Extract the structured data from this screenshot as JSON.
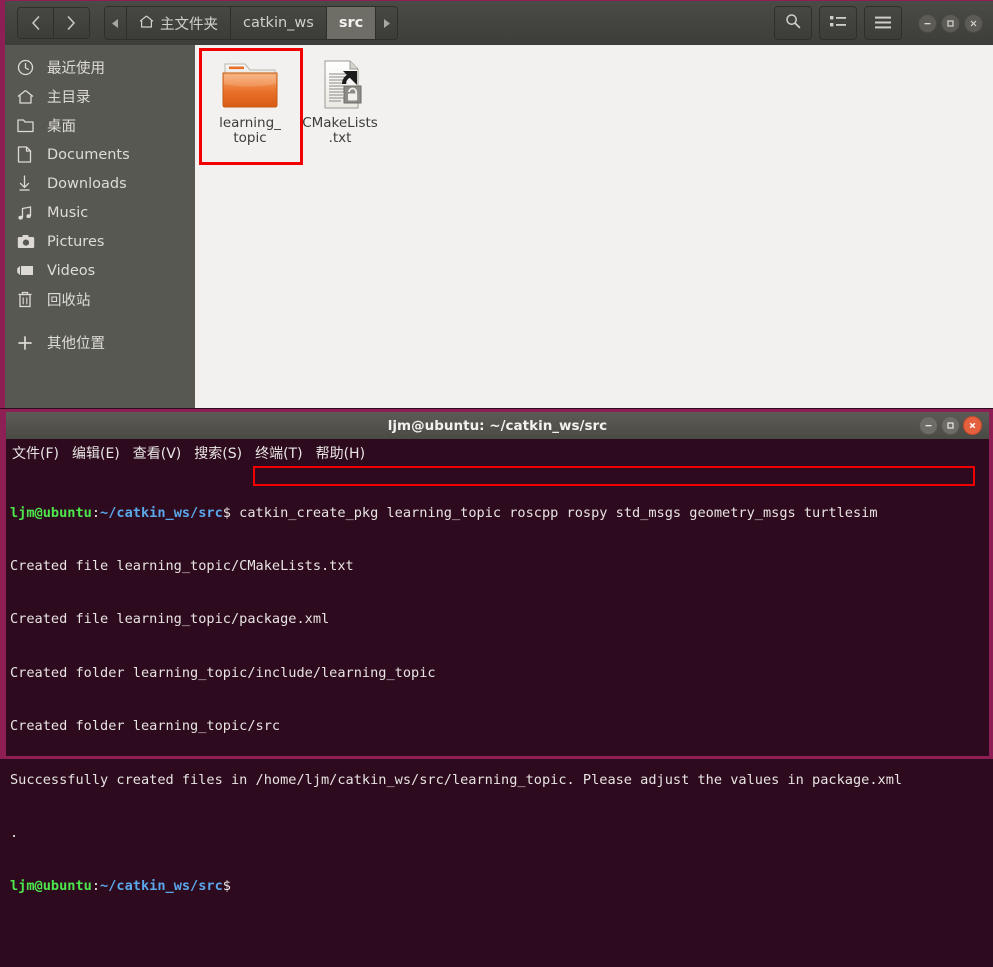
{
  "file_manager": {
    "nav": {
      "back": "‹",
      "forward": "›"
    },
    "breadcrumb": {
      "left_arrow": "◂",
      "right_arrow": "▸",
      "items": [
        {
          "label": "主文件夹",
          "icon": "home-icon",
          "active": false
        },
        {
          "label": "catkin_ws",
          "icon": "",
          "active": false
        },
        {
          "label": "src",
          "icon": "",
          "active": true
        }
      ]
    },
    "toolbar_right": {
      "search": "search-icon",
      "view_list": "list-view-icon",
      "menu": "hamburger-menu-icon",
      "minimize": "–",
      "maximize": "▣",
      "close": "×"
    },
    "sidebar": {
      "items": [
        {
          "label": "最近使用",
          "icon": "clock-icon"
        },
        {
          "label": "主目录",
          "icon": "home-icon"
        },
        {
          "label": "桌面",
          "icon": "folder-icon"
        },
        {
          "label": "Documents",
          "icon": "document-icon"
        },
        {
          "label": "Downloads",
          "icon": "download-icon"
        },
        {
          "label": "Music",
          "icon": "music-note-icon"
        },
        {
          "label": "Pictures",
          "icon": "camera-icon"
        },
        {
          "label": "Videos",
          "icon": "video-icon"
        },
        {
          "label": "回收站",
          "icon": "trash-icon"
        },
        {
          "label": "其他位置",
          "icon": "plus-icon"
        }
      ]
    },
    "files": [
      {
        "name": "learning_\ntopic",
        "type": "folder",
        "selected": true
      },
      {
        "name": "CMakeLists\n.txt",
        "type": "text-file-locked",
        "selected": false
      }
    ]
  },
  "terminal": {
    "title": "ljm@ubuntu: ~/catkin_ws/src",
    "window_controls": {
      "minimize": "–",
      "maximize": "▣",
      "close": "✕"
    },
    "menu": [
      "文件(F)",
      "编辑(E)",
      "查看(V)",
      "搜索(S)",
      "终端(T)",
      "帮助(H)"
    ],
    "prompt_user": "ljm@ubuntu",
    "prompt_sep": ":",
    "prompt_path": "~/catkin_ws/src",
    "prompt_dollar": "$ ",
    "command": "catkin_create_pkg learning_topic roscpp rospy std_msgs geometry_msgs turtlesim",
    "output_lines": [
      "Created file learning_topic/CMakeLists.txt",
      "Created file learning_topic/package.xml",
      "Created folder learning_topic/include/learning_topic",
      "Created folder learning_topic/src",
      "Successfully created files in /home/ljm/catkin_ws/src/learning_topic. Please adjust the values in package.xml",
      "."
    ],
    "final_prompt_dollar": "$"
  },
  "colors": {
    "window_border": "#8e1f55",
    "terminal_bg": "#2d0a1e",
    "annotation_red": "#f20000",
    "prompt_green": "#4ce64c",
    "prompt_blue": "#5aa7ea",
    "folder_orange": "#e8761f"
  }
}
